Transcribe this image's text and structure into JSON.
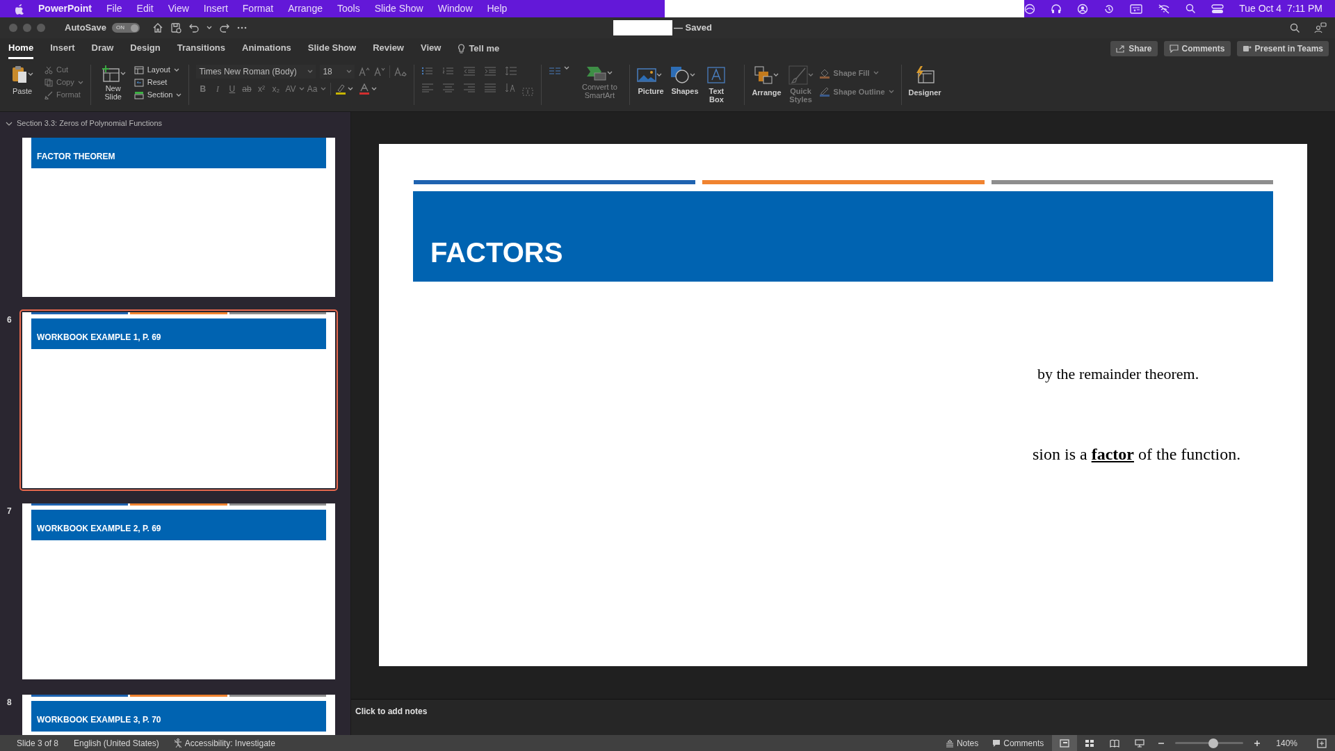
{
  "menu_bar": {
    "app": "PowerPoint",
    "items": [
      "File",
      "Edit",
      "View",
      "Insert",
      "Format",
      "Arrange",
      "Tools",
      "Slide Show",
      "Window",
      "Help"
    ],
    "clock": "Tue Oct 4  7:11 PM"
  },
  "title_bar": {
    "autosave": "AutoSave",
    "autosave_on": true,
    "toggle_label": "ON",
    "status": "— Saved"
  },
  "tabs": [
    {
      "label": "Home",
      "selected": true
    },
    {
      "label": "Insert",
      "selected": false
    },
    {
      "label": "Draw",
      "selected": false
    },
    {
      "label": "Design",
      "selected": false
    },
    {
      "label": "Transitions",
      "selected": false
    },
    {
      "label": "Animations",
      "selected": false
    },
    {
      "label": "Slide Show",
      "selected": false
    },
    {
      "label": "Review",
      "selected": false
    },
    {
      "label": "View",
      "selected": false
    }
  ],
  "tell_me": "Tell me",
  "share_buttons": [
    {
      "kind": "share",
      "label": "Share"
    },
    {
      "kind": "comments",
      "label": "Comments"
    },
    {
      "kind": "teams",
      "label": "Present in Teams"
    }
  ],
  "ribbon": {
    "paste": "Paste",
    "clipboard": [
      {
        "kind": "cut",
        "label": "Cut",
        "disabled": true
      },
      {
        "kind": "copy",
        "label": "Copy",
        "disabled": true
      },
      {
        "kind": "format",
        "label": "Format",
        "disabled": true
      }
    ],
    "new_slide": "New Slide",
    "slide_buttons": [
      "Layout",
      "Reset",
      "Section"
    ],
    "font_name": "Times New Roman (Body)",
    "font_size": "18",
    "format_buttons": [
      {
        "label": "B",
        "disabled": true
      },
      {
        "label": "I",
        "disabled": true
      },
      {
        "label": "U",
        "disabled": true
      },
      {
        "label": "ab",
        "disabled": true
      },
      {
        "label": "x²",
        "disabled": true
      },
      {
        "label": "x₂",
        "disabled": true
      },
      {
        "label": "AV",
        "disabled": true
      },
      {
        "label": "Aa",
        "disabled": true
      }
    ],
    "convert": "Convert to SmartArt",
    "insert_buttons": [
      {
        "kind": "picture",
        "label": "Picture"
      },
      {
        "kind": "shapes",
        "label": "Shapes"
      },
      {
        "kind": "textbox",
        "label": "Text Box"
      }
    ],
    "arrange": "Arrange",
    "quick_styles": {
      "label": "Quick Styles",
      "disabled": true
    },
    "shape_buttons": [
      {
        "kind": "fill",
        "label": "Shape Fill",
        "disabled": true
      },
      {
        "kind": "outline",
        "label": "Shape Outline",
        "disabled": true
      }
    ],
    "designer": "Designer"
  },
  "section": {
    "label": "Section 3.3: Zeros of Polynomial Functions",
    "expanded": true
  },
  "thumbnails": [
    {
      "title": "FACTOR THEOREM",
      "selected": false,
      "cut_top": true
    },
    {
      "number": "6",
      "title": "WORKBOOK EXAMPLE 1, P. 69",
      "selected": true
    },
    {
      "number": "7",
      "title": "WORKBOOK EXAMPLE 2, P. 69",
      "selected": false
    },
    {
      "number": "8",
      "title": "WORKBOOK EXAMPLE 3, P. 70",
      "selected": false
    }
  ],
  "slide": {
    "title": "FACTORS",
    "paragraphs": [
      "by the remainder theorem.",
      "sion is a **factor** of the function."
    ]
  },
  "notes_placeholder": "Click to add notes",
  "status_bar": {
    "slide": "Slide 3 of 8",
    "language": "English (United States)",
    "accessibility": "Accessibility: Investigate",
    "notes": "Notes",
    "comments": "Comments",
    "views": [
      {
        "kind": "normal",
        "selected": true
      },
      {
        "kind": "sorter",
        "selected": false
      },
      {
        "kind": "reading",
        "selected": false
      },
      {
        "kind": "slideshow",
        "selected": false
      }
    ],
    "zoom": {
      "level": 0.56,
      "reading": "140%"
    }
  }
}
